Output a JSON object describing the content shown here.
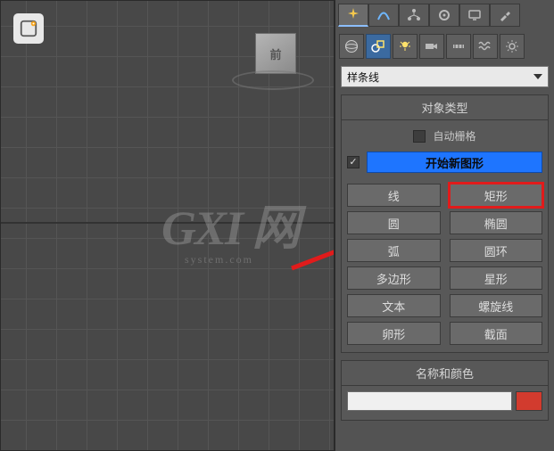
{
  "viewport": {
    "viewcube_face": "前",
    "watermark_main": "GXI 网",
    "watermark_sub": "system.com"
  },
  "panel": {
    "tabs": [
      {
        "name": "create"
      },
      {
        "name": "modify"
      },
      {
        "name": "hierarchy"
      },
      {
        "name": "motion"
      },
      {
        "name": "display"
      },
      {
        "name": "utilities"
      }
    ],
    "category_icons": [
      {
        "name": "geometry"
      },
      {
        "name": "shapes"
      },
      {
        "name": "lights"
      },
      {
        "name": "cameras"
      },
      {
        "name": "helpers"
      },
      {
        "name": "spacewarps"
      },
      {
        "name": "systems"
      }
    ],
    "dropdown_value": "样条线",
    "rollout_object_type": {
      "title": "对象类型",
      "autogrid_label": "自动栅格",
      "autogrid_checked": false,
      "startnew_checked": true,
      "startnew_label": "开始新图形",
      "buttons": [
        {
          "label": "线"
        },
        {
          "label": "矩形"
        },
        {
          "label": "圆"
        },
        {
          "label": "椭圆"
        },
        {
          "label": "弧"
        },
        {
          "label": "圆环"
        },
        {
          "label": "多边形"
        },
        {
          "label": "星形"
        },
        {
          "label": "文本"
        },
        {
          "label": "螺旋线"
        },
        {
          "label": "卵形"
        },
        {
          "label": "截面"
        }
      ]
    },
    "rollout_name_color": {
      "title": "名称和颜色",
      "name_value": "",
      "color": "#d23b2e"
    }
  }
}
